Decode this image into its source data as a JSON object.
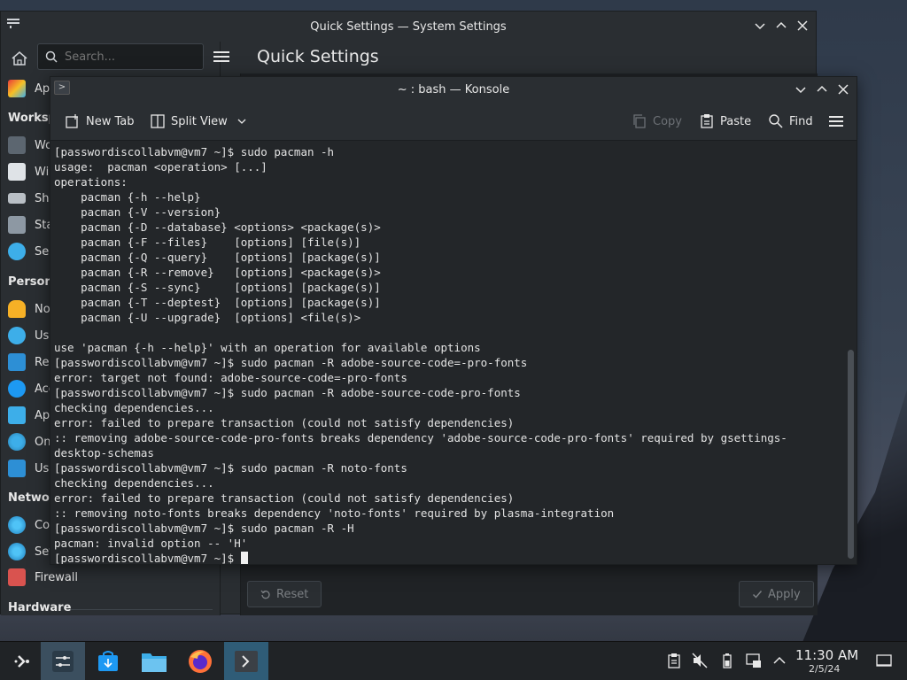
{
  "system_settings": {
    "title": "Quick Settings — System Settings",
    "search_placeholder": "Search...",
    "heading": "Quick Settings",
    "sidebar": {
      "items_top": [
        {
          "label": "Ap",
          "icon": "appearance-icon"
        }
      ],
      "sections": [
        {
          "label": "Worksp",
          "items": [
            {
              "label": "Wo",
              "icon": "workspace-behavior-icon"
            },
            {
              "label": "Wi",
              "icon": "window-management-icon"
            },
            {
              "label": "Sh",
              "icon": "shortcuts-icon"
            },
            {
              "label": "Sta",
              "icon": "startup-icon"
            },
            {
              "label": "Sea",
              "icon": "search-icon"
            }
          ]
        },
        {
          "label": "Persona",
          "items": [
            {
              "label": "No",
              "icon": "notifications-icon"
            },
            {
              "label": "Us",
              "icon": "users-icon"
            },
            {
              "label": "Re",
              "icon": "regional-icon"
            },
            {
              "label": "Acc",
              "icon": "accessibility-icon"
            },
            {
              "label": "Ap",
              "icon": "applications-icon"
            },
            {
              "label": "On",
              "icon": "online-accounts-icon"
            },
            {
              "label": "Us",
              "icon": "user-feedback-icon"
            }
          ]
        },
        {
          "label": "Netwo",
          "items": [
            {
              "label": "Co",
              "icon": "connections-icon"
            },
            {
              "label": "Set",
              "icon": "network-settings-icon"
            },
            {
              "label": "Firewall",
              "icon": "firewall-icon"
            }
          ]
        },
        {
          "label": "Hardware",
          "items": []
        }
      ]
    },
    "buttons": {
      "reset": "Reset",
      "apply": "Apply"
    }
  },
  "konsole": {
    "title": "~ : bash — Konsole",
    "toolbar": {
      "new_tab": "New Tab",
      "split_view": "Split View",
      "copy": "Copy",
      "paste": "Paste",
      "find": "Find"
    },
    "lines": [
      "[passwordiscollabvm@vm7 ~]$ sudo pacman -h",
      "usage:  pacman <operation> [...]",
      "operations:",
      "    pacman {-h --help}",
      "    pacman {-V --version}",
      "    pacman {-D --database} <options> <package(s)>",
      "    pacman {-F --files}    [options] [file(s)]",
      "    pacman {-Q --query}    [options] [package(s)]",
      "    pacman {-R --remove}   [options] <package(s)>",
      "    pacman {-S --sync}     [options] [package(s)]",
      "    pacman {-T --deptest}  [options] [package(s)]",
      "    pacman {-U --upgrade}  [options] <file(s)>",
      "",
      "use 'pacman {-h --help}' with an operation for available options",
      "[passwordiscollabvm@vm7 ~]$ sudo pacman -R adobe-source-code=-pro-fonts",
      "error: target not found: adobe-source-code=-pro-fonts",
      "[passwordiscollabvm@vm7 ~]$ sudo pacman -R adobe-source-code-pro-fonts",
      "checking dependencies...",
      "error: failed to prepare transaction (could not satisfy dependencies)",
      ":: removing adobe-source-code-pro-fonts breaks dependency 'adobe-source-code-pro-fonts' required by gsettings-",
      "desktop-schemas",
      "[passwordiscollabvm@vm7 ~]$ sudo pacman -R noto-fonts",
      "checking dependencies...",
      "error: failed to prepare transaction (could not satisfy dependencies)",
      ":: removing noto-fonts breaks dependency 'noto-fonts' required by plasma-integration",
      "[passwordiscollabvm@vm7 ~]$ sudo pacman -R -H",
      "pacman: invalid option -- 'H'",
      "[passwordiscollabvm@vm7 ~]$ "
    ]
  },
  "taskbar": {
    "apps": [
      {
        "name": "application-launcher-icon"
      },
      {
        "name": "system-settings-icon"
      },
      {
        "name": "discover-icon"
      },
      {
        "name": "dolphin-file-manager-icon"
      },
      {
        "name": "firefox-icon"
      },
      {
        "name": "konsole-icon"
      }
    ],
    "clock": {
      "time": "11:30 AM",
      "date": "2/5/24"
    }
  }
}
